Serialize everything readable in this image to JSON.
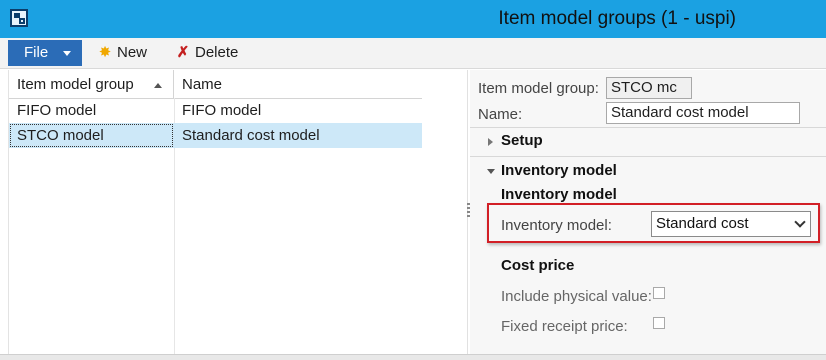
{
  "window": {
    "title": "Item model groups (1 - uspi)"
  },
  "toolbar": {
    "file_label": "File",
    "new_label": "New",
    "delete_label": "Delete"
  },
  "grid": {
    "columns": [
      "Item model group",
      "Name"
    ],
    "rows": [
      {
        "group": "FIFO model",
        "name": "FIFO model",
        "selected": false
      },
      {
        "group": "STCO model",
        "name": "Standard cost model",
        "selected": true
      }
    ]
  },
  "detail": {
    "item_model_group_label": "Item model group:",
    "item_model_group_value": "STCO mc",
    "name_label": "Name:",
    "name_value": "Standard cost model",
    "setup_tab": "Setup",
    "inventory_tab": "Inventory model",
    "inventory_group_title": "Inventory model",
    "inventory_model_label": "Inventory model:",
    "inventory_model_value": "Standard cost",
    "cost_price_title": "Cost price",
    "include_physical_label": "Include physical value:",
    "include_physical_checked": false,
    "fixed_receipt_label": "Fixed receipt price:",
    "fixed_receipt_checked": false
  },
  "colors": {
    "titlebar": "#1ba1e2",
    "file_button": "#2b6cb7",
    "selection": "#cde8f8",
    "highlight_border": "#d21f26"
  }
}
